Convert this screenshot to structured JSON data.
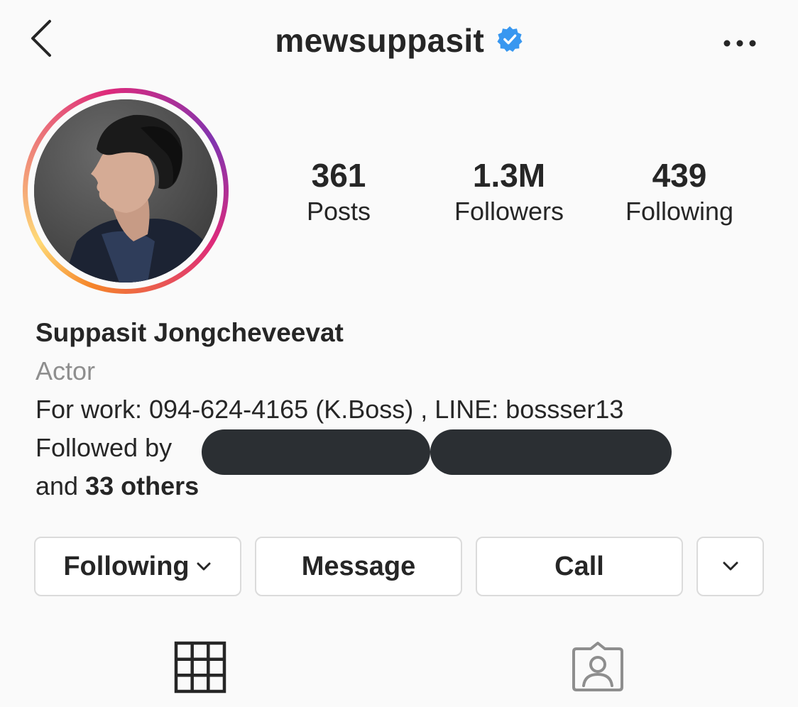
{
  "header": {
    "username": "mewsuppasit",
    "verified": true,
    "back_icon": "chevron-left-icon",
    "more_icon": "more-horizontal-icon"
  },
  "stats": {
    "posts": {
      "value": "361",
      "label": "Posts"
    },
    "followers": {
      "value": "1.3M",
      "label": "Followers"
    },
    "following": {
      "value": "439",
      "label": "Following"
    }
  },
  "bio": {
    "full_name": "Suppasit Jongcheveevat",
    "category": "Actor",
    "line": "For work: 094-624-4165 (K.Boss) , LINE: bossser13",
    "followed_by_prefix": "Followed by",
    "and_text": "and",
    "others_text": "33 others"
  },
  "buttons": {
    "following": "Following",
    "message": "Message",
    "call": "Call"
  },
  "tabs": {
    "grid_icon": "grid-icon",
    "tagged_icon": "tagged-person-icon"
  },
  "colors": {
    "verified_blue": "#3897f0",
    "text": "#262626",
    "muted": "#8e8e8e",
    "border": "#dbdbdb",
    "background": "#fafafa"
  }
}
